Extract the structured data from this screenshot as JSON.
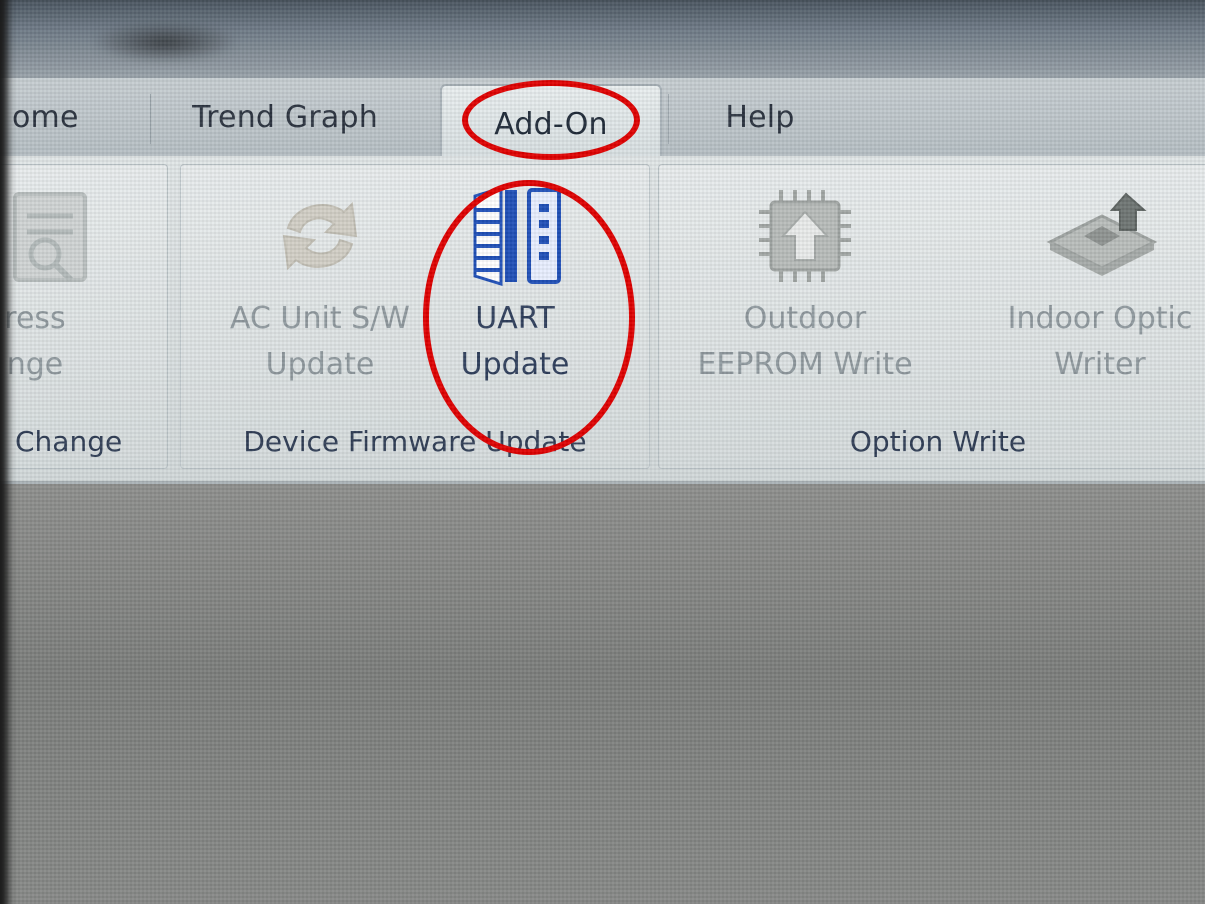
{
  "tabs": {
    "home": "ome",
    "trend_graph": "Trend Graph",
    "add_on": "Add-On",
    "help": "Help"
  },
  "ribbon": {
    "groups": {
      "address": {
        "label": "Change"
      },
      "firmware": {
        "label": "Device Firmware Update"
      },
      "option": {
        "label": "Option Write"
      }
    },
    "buttons": {
      "address": {
        "line1": "ress",
        "line2": "nge",
        "icon": "address-document-icon"
      },
      "ac_unit": {
        "line1": "AC Unit S/W",
        "line2": "Update",
        "icon": "refresh-arrows-icon"
      },
      "uart": {
        "line1": "UART",
        "line2": "Update",
        "icon": "uart-connector-icon"
      },
      "outdoor": {
        "line1": "Outdoor",
        "line2": "EEPROM Write",
        "icon": "chip-upload-icon"
      },
      "indoor": {
        "line1": "Indoor Optic",
        "line2": "Writer",
        "icon": "board-upload-icon"
      }
    }
  },
  "colors": {
    "highlight": "#e00000",
    "enabled_text": "#2f3f5c",
    "disabled_text": "#8f999e",
    "accent_blue": "#1f4fb8"
  }
}
